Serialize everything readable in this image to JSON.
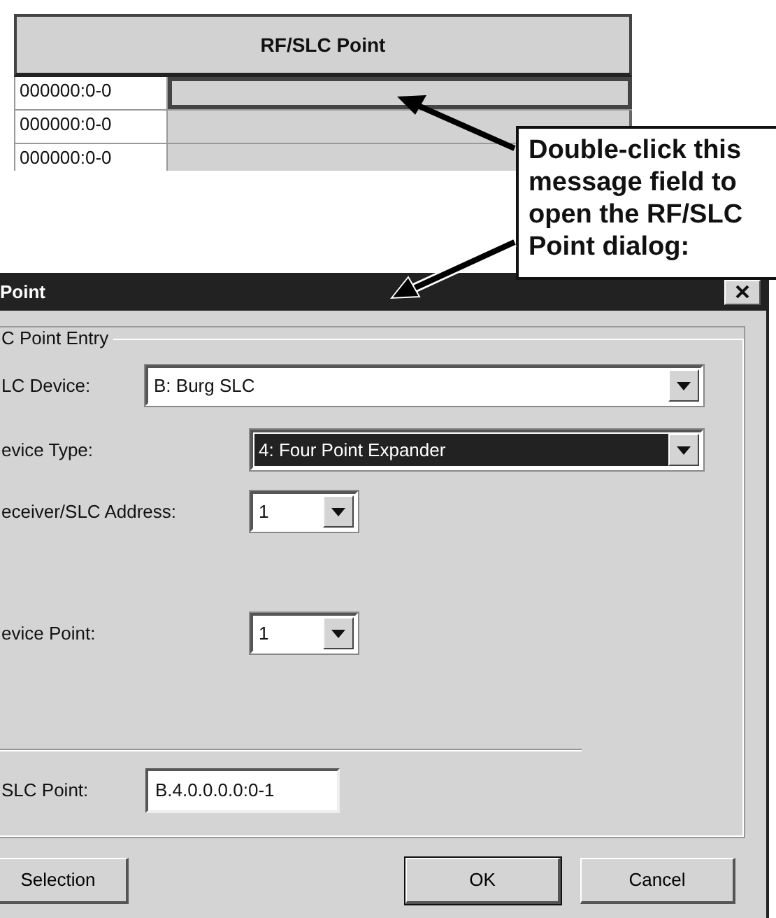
{
  "grid": {
    "header": "RF/SLC Point",
    "rows": [
      {
        "address": "000000:0-0",
        "selected": true
      },
      {
        "address": "000000:0-0",
        "selected": false
      },
      {
        "address": "000000:0-0",
        "selected": false
      }
    ]
  },
  "callout": {
    "text": "Double-click this message field to open the RF/SLC Point dialog:"
  },
  "dialog": {
    "title": "Point",
    "group": {
      "legend": "C Point Entry",
      "fields": [
        {
          "kind": "combo",
          "label": "LC Device:",
          "value": "B: Burg SLC",
          "focused": false
        },
        {
          "kind": "combo",
          "label": "evice Type:",
          "value": "4: Four Point Expander",
          "focused": true
        },
        {
          "kind": "combo",
          "label": "eceiver/SLC Address:",
          "value": "1",
          "focused": false
        },
        {
          "kind": "combo",
          "label": "evice Point:",
          "value": "1",
          "focused": false
        },
        {
          "kind": "text",
          "label": "SLC Point:",
          "value": "B.4.0.0.0.0:0-1"
        }
      ]
    },
    "buttons": [
      {
        "label": "Selection",
        "default": false
      },
      {
        "label": "OK",
        "default": true
      },
      {
        "label": "Cancel",
        "default": false
      }
    ]
  }
}
